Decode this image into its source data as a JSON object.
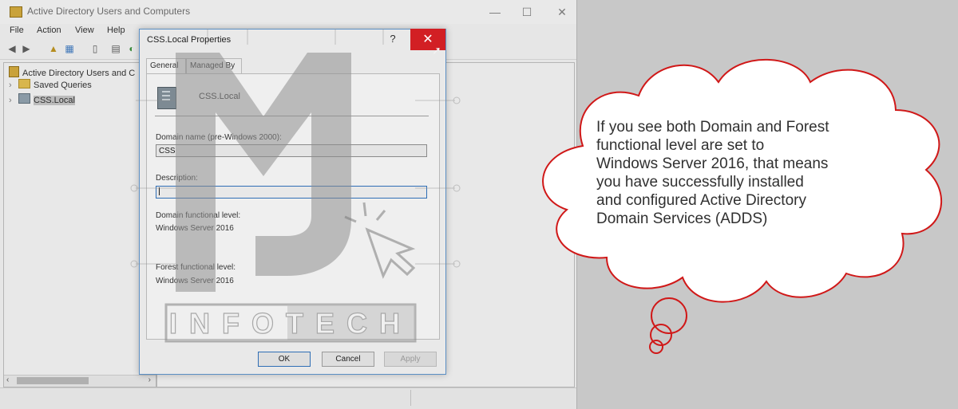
{
  "window": {
    "title": "Active Directory Users and Computers",
    "controls": {
      "minimize": "—",
      "maximize": "☐",
      "close": "✕"
    }
  },
  "menu": [
    "File",
    "Action",
    "View",
    "Help"
  ],
  "tree": {
    "root": "Active Directory Users and C",
    "items": [
      "Saved Queries",
      "CSS.Local"
    ]
  },
  "dialog": {
    "title": "CSS.Local Properties",
    "help": "?",
    "close": "✕",
    "tabs": [
      "General",
      "Managed By"
    ],
    "object_name": "CSS.Local",
    "domain_name_label": "Domain name (pre-Windows 2000):",
    "domain_name_value": "CSS",
    "description_label": "Description:",
    "description_value": "",
    "domain_level_label": "Domain functional level:",
    "domain_level_value": "Windows Server 2016",
    "forest_level_label": "Forest functional level:",
    "forest_level_value": "Windows Server 2016",
    "buttons": {
      "ok": "OK",
      "cancel": "Cancel",
      "apply": "Apply"
    }
  },
  "watermark": {
    "text": "INFOTECH"
  },
  "callout": {
    "text_lines": [
      "If you see both Domain and Forest",
      "functional level are set to",
      "Windows Server 2016, that means",
      "you have successfully installed",
      "and configured Active Directory",
      "Domain Services (ADDS)"
    ],
    "border_color": "#d01818"
  }
}
